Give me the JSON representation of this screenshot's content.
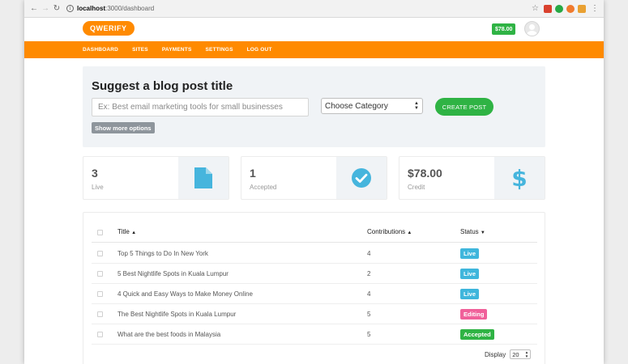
{
  "browser": {
    "url_host": "localhost",
    "url_path": ":3000/dashboard"
  },
  "header": {
    "logo": "QWERIFY",
    "balance": "$78.00"
  },
  "nav": [
    "DASHBOARD",
    "SITES",
    "PAYMENTS",
    "SETTINGS",
    "LOG OUT"
  ],
  "suggest": {
    "title": "Suggest a blog post title",
    "input_placeholder": "Ex: Best email marketing tools for small businesses",
    "category_selected": "Choose Category",
    "create_label": "CREATE POST",
    "more_label": "Show more options"
  },
  "stats": [
    {
      "value": "3",
      "label": "Live",
      "icon": "document-icon"
    },
    {
      "value": "1",
      "label": "Accepted",
      "icon": "check-circle-icon"
    },
    {
      "value": "$78.00",
      "label": "Credit",
      "icon": "dollar-icon"
    }
  ],
  "table": {
    "headers": {
      "title": "Title",
      "contributions": "Contributions",
      "status": "Status"
    },
    "rows": [
      {
        "title": "Top 5 Things to Do In New York",
        "contributions": "4",
        "status": "Live"
      },
      {
        "title": "5 Best Nightlife Spots in Kuala Lumpur",
        "contributions": "2",
        "status": "Live"
      },
      {
        "title": "4 Quick and Easy Ways to Make Money Online",
        "contributions": "4",
        "status": "Live"
      },
      {
        "title": "The Best Nightlife Spots in Kuala Lumpur",
        "contributions": "5",
        "status": "Editing"
      },
      {
        "title": "What are the best foods in Malaysia",
        "contributions": "5",
        "status": "Accepted"
      }
    ],
    "display_label": "Display",
    "display_value": "20"
  },
  "colors": {
    "brand": "#ff8a00",
    "success": "#2fb344",
    "live": "#3fb6dc",
    "editing": "#f0609a",
    "accepted": "#2fb344",
    "icon": "#46b5dd"
  }
}
